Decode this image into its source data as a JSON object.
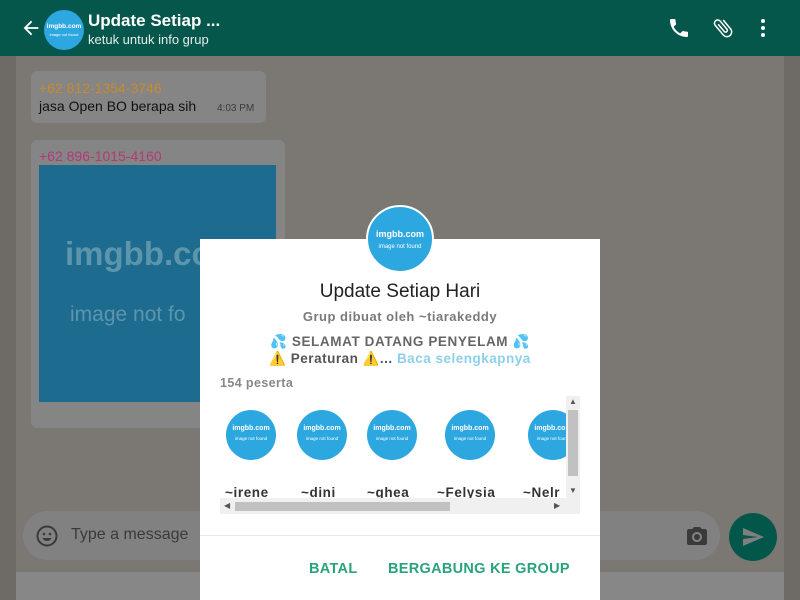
{
  "header": {
    "title": "Update Setiap ...",
    "subtitle": "ketuk untuk info grup",
    "avatar": {
      "brand": "imgbb.com",
      "caption": "image not found"
    },
    "icons": [
      "back-arrow-icon",
      "phone-icon",
      "paperclip-icon",
      "more-vert-icon"
    ]
  },
  "messages": [
    {
      "sender": "+62 812-1354-3746",
      "sender_color": "#c98a2e",
      "text": "jasa Open BO berapa sih",
      "time": "4:03 PM"
    },
    {
      "sender": "+62 896-1015-4160",
      "sender_color": "#b3397a",
      "media": {
        "brand": "imgbb.co",
        "caption": "image not fo"
      }
    }
  ],
  "composer": {
    "placeholder": "Type a message"
  },
  "dialog": {
    "avatar": {
      "brand": "imgbb.com",
      "caption": "image not found"
    },
    "title": "Update Setiap Hari",
    "creator": "Grup dibuat oleh ~tiarakeddy",
    "desc_line1": "SELAMAT DATANG PENYELAM",
    "desc_line1_emoji": "💦",
    "desc_line2_prefix": "Peraturan",
    "desc_line2_warn": "⚠️",
    "desc_line2_ellipsis": "...",
    "read_more": "Baca selengkapnya",
    "participant_count": "154 peserta",
    "members": [
      {
        "name": "~irene",
        "brand": "imgbb.com",
        "caption": "image not found"
      },
      {
        "name": "~dini",
        "brand": "imgbb.com",
        "caption": "image not found"
      },
      {
        "name": "~ghea",
        "brand": "imgbb.com",
        "caption": "image not found"
      },
      {
        "name": "~Felysia",
        "brand": "imgbb.com",
        "caption": "image not found"
      },
      {
        "name": "~Nelr",
        "brand": "imgbb.com",
        "caption": "image not found"
      }
    ],
    "cancel_label": "BATAL",
    "join_label": "BERGABUNG KE GROUP"
  },
  "colors": {
    "header_bg": "#04574a",
    "accent": "#2aa37c",
    "avatar_bg": "#2da7e0",
    "link": "#8dd0ec"
  }
}
